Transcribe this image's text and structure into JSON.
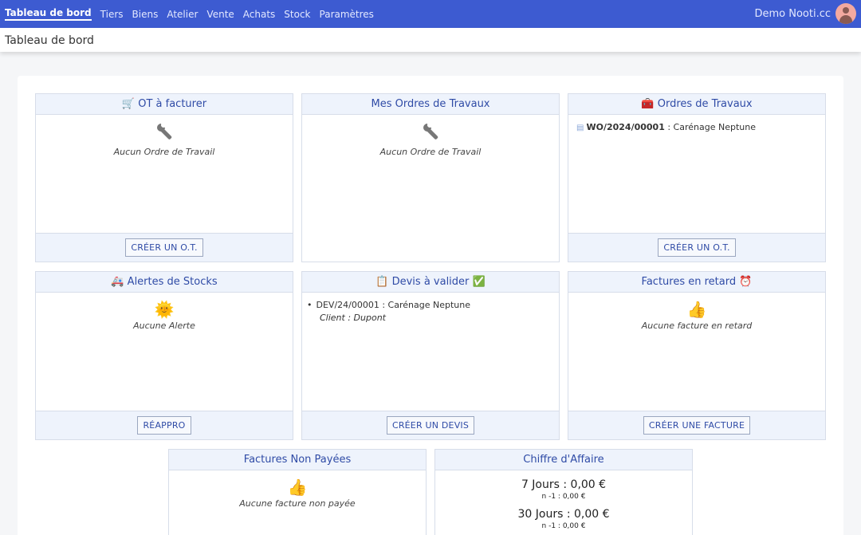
{
  "nav": {
    "items": [
      {
        "label": "Tableau de bord",
        "active": true
      },
      {
        "label": "Tiers"
      },
      {
        "label": "Biens"
      },
      {
        "label": "Atelier"
      },
      {
        "label": "Vente"
      },
      {
        "label": "Achats"
      },
      {
        "label": "Stock"
      },
      {
        "label": "Paramètres"
      }
    ],
    "user": "Demo Nooti.cc",
    "accent": "#3d5bd1"
  },
  "page_title": "Tableau de bord",
  "cards": {
    "ot_facturer": {
      "icon": "cart-icon",
      "glyph": "🛒",
      "title": "OT à facturer",
      "empty_icon": "wrench-icon",
      "empty": "Aucun Ordre de Travail",
      "button": "CRÉER UN O.T."
    },
    "mes_ordres": {
      "title": "Mes Ordres de Travaux",
      "empty_icon": "wrench-icon",
      "empty": "Aucun Ordre de Travail"
    },
    "ordres_travaux": {
      "icon": "toolbox-icon",
      "glyph": "🧰",
      "title": "Ordres de Travaux",
      "items": [
        {
          "ref": "WO/2024/00001",
          "label": " : Carénage Neptune"
        }
      ],
      "button": "CRÉER UN O.T."
    },
    "alertes_stocks": {
      "icon": "ambulance-icon",
      "glyph": "🚑",
      "title": "Alertes de Stocks",
      "empty_icon": "sun-icon",
      "empty_glyph": "🌞",
      "empty": "Aucune Alerte",
      "button": "RÉAPPRO"
    },
    "devis": {
      "icon": "clipboard-icon",
      "glyph": "📋",
      "title": "Devis à valider",
      "icon2": "check-icon",
      "glyph2": "✅",
      "items": [
        {
          "ref": "DEV/24/00001 : Carénage Neptune",
          "client": "Client : Dupont"
        }
      ],
      "button": "CRÉER UN DEVIS"
    },
    "factures_retard": {
      "title": "Factures en retard",
      "icon": "alarm-clock-icon",
      "glyph": "⏰",
      "empty_icon": "thumbs-up-icon",
      "empty_glyph": "👍",
      "empty": "Aucune facture en retard",
      "button": "CRÉER UNE FACTURE"
    },
    "factures_non_payees": {
      "title": "Factures Non Payées",
      "empty_icon": "thumbs-up-icon",
      "empty_glyph": "👍",
      "empty": "Aucune facture non payée"
    },
    "chiffre_affaire": {
      "title": "Chiffre d'Affaire",
      "rows": [
        {
          "label": "7 Jours : ",
          "value": "0,00 €",
          "prev_label": "n -1 : ",
          "prev_value": "0,00 €"
        },
        {
          "label": "30 Jours : ",
          "value": "0,00 €",
          "prev_label": "n -1 : ",
          "prev_value": "0,00 €"
        }
      ]
    }
  }
}
